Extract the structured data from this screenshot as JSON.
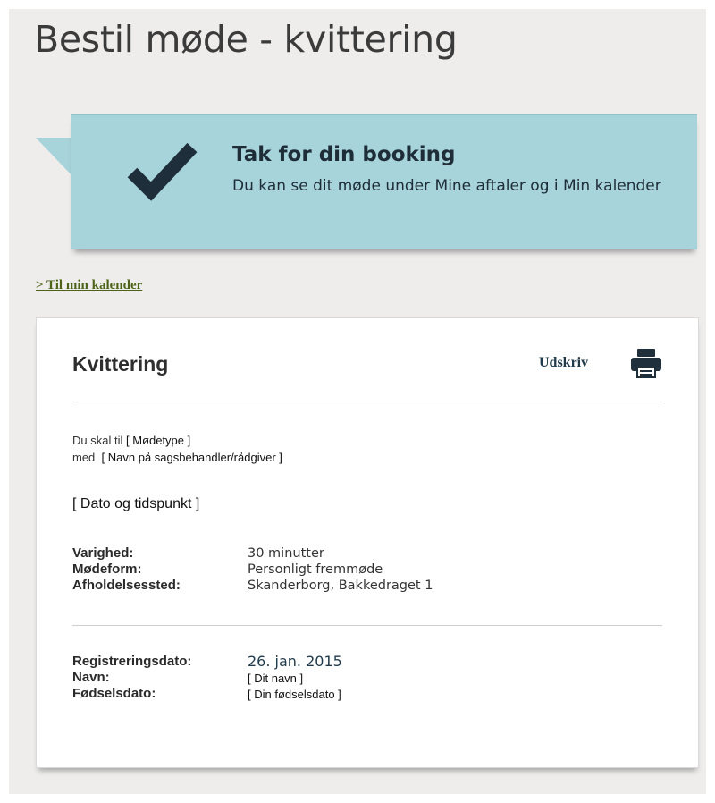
{
  "page": {
    "title": "Bestil møde - kvittering"
  },
  "banner": {
    "heading": "Tak for din booking",
    "text": "Du kan se dit møde under Mine aftaler og i Min kalender",
    "icon": "checkmark-icon",
    "color": "#a7d3da"
  },
  "links": {
    "calendar": "> Til min kalender"
  },
  "receipt": {
    "title": "Kvittering",
    "print_label": "Udskriv",
    "print_icon": "printer-icon",
    "intro_line1_prefix": "Du skal til",
    "intro_line1_placeholder": "[ Mødetype ]",
    "intro_line2_prefix": "med",
    "intro_line2_placeholder": "[ Navn på sagsbehandler/rådgiver ]",
    "datetime_placeholder": "[ Dato og tidspunkt ]",
    "details": [
      {
        "label": "Varighed:",
        "value": "30 minutter"
      },
      {
        "label": "Mødeform:",
        "value": "Personligt fremmøde"
      },
      {
        "label": "Afholdelsessted:",
        "value": "Skanderborg, Bakkedraget 1"
      }
    ],
    "registration": [
      {
        "label": "Registreringsdato:",
        "value": "26. jan. 2015"
      },
      {
        "label": "Navn:",
        "value": "[ Dit navn ]"
      },
      {
        "label": "Fødselsdato:",
        "value": "[ Din fødselsdato ]"
      }
    ]
  }
}
